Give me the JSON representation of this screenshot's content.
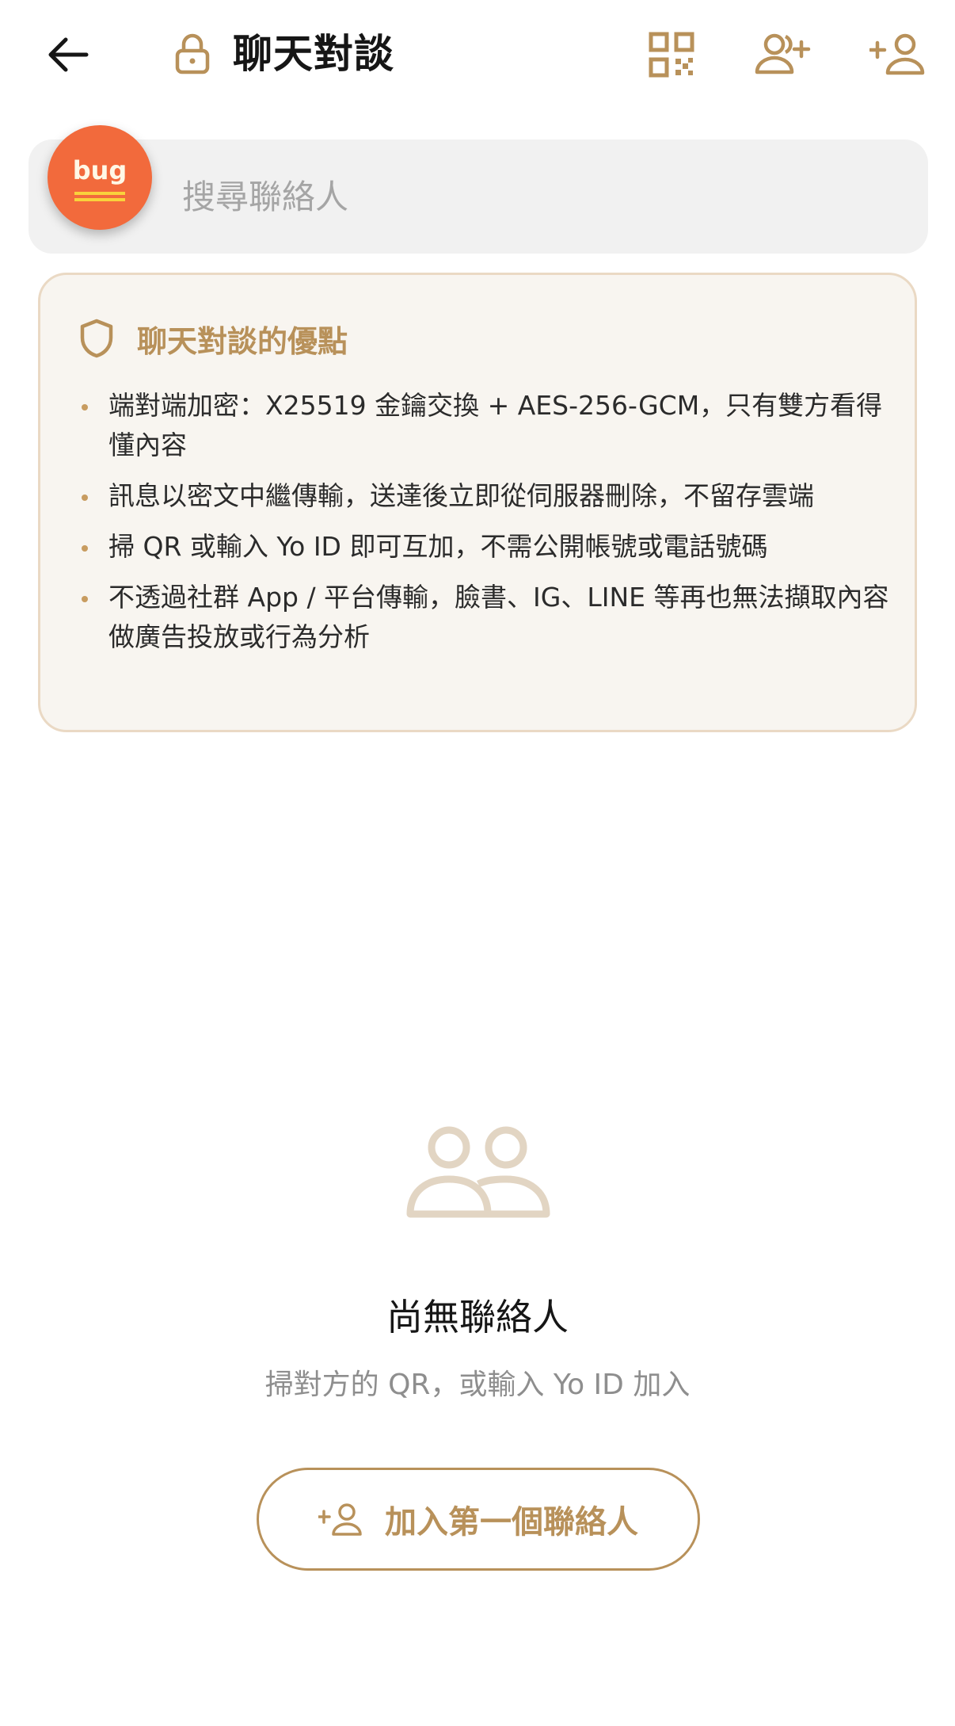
{
  "header": {
    "title": "聊天對談",
    "icons": {
      "back": "arrow-left-icon",
      "lock": "lock-icon",
      "qr": "qr-code-icon",
      "add_friend": "user-plus-icon",
      "add_contact": "person-add-icon"
    }
  },
  "search": {
    "placeholder": "搜尋聯絡人",
    "value": ""
  },
  "debug_badge": {
    "label": "bug"
  },
  "benefits": {
    "title": "聊天對談的優點",
    "items": [
      "端對端加密：X25519 金鑰交換 + AES-256-GCM，只有雙方看得懂內容",
      "訊息以密文中繼傳輸，送達後立即從伺服器刪除，不留存雲端",
      "掃 QR 或輸入 Yo ID 即可互加，不需公開帳號或電話號碼",
      "不透過社群 App / 平台傳輸，臉書、IG、LINE 等再也無法擷取內容做廣告投放或行為分析"
    ]
  },
  "empty_state": {
    "title": "尚無聯絡人",
    "subtitle": "掃對方的 QR，或輸入 Yo ID 加入",
    "button_label": "加入第一個聯絡人"
  },
  "colors": {
    "accent": "#b8915a",
    "card_bg": "#f8f5f0",
    "card_border": "#ead9c4",
    "search_bg": "#f1f1f1",
    "debug_badge": "#f26a3c"
  }
}
